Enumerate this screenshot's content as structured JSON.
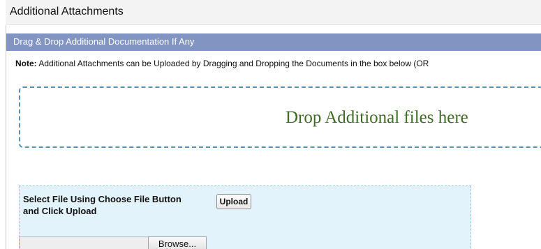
{
  "section": {
    "title": "Additional Attachments",
    "header": "Drag & Drop Additional Documentation If Any"
  },
  "note": {
    "label": "Note:",
    "text": "Additional Attachments can be Uploaded by Dragging and Dropping the Documents in the box below (OR"
  },
  "drop_zone": {
    "text": "Drop Additional files here"
  },
  "file_select": {
    "label_line1": "Select File Using Choose File Button",
    "label_line2": "and Click Upload",
    "upload_label": "Upload",
    "browse_label": "Browse..."
  },
  "colors": {
    "header_bg": "#8294c2",
    "drop_border": "#5b8fae",
    "drop_text": "#3f6b26",
    "file_box_bg": "#e3f3fb"
  }
}
